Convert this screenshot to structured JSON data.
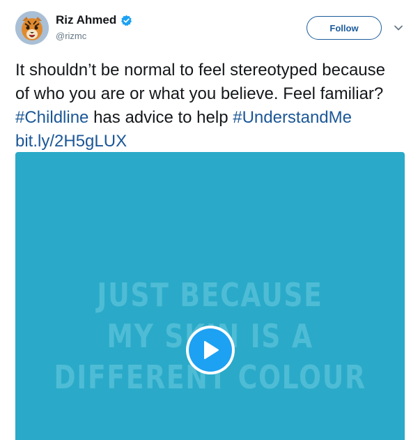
{
  "user": {
    "display_name": "Riz Ahmed",
    "handle": "@rizmc",
    "verified": true
  },
  "actions": {
    "follow_label": "Follow"
  },
  "tweet": {
    "text_part1": "It shouldn’t be normal to feel stereotyped because of who you are or what you believe. Feel familiar? ",
    "hashtag1": "#Childline",
    "text_part2": " has advice to help ",
    "hashtag2": "#UnderstandMe",
    "space": " ",
    "link": "bit.ly/2H5gLUX"
  },
  "media": {
    "type": "video",
    "overlay_text_lines": [
      "JUST BECAUSE",
      "MY SKIN IS A",
      "DIFFERENT COLOUR"
    ],
    "background_color": "#2aaac8"
  },
  "colors": {
    "link": "#1b5797",
    "accent": "#1da1f2",
    "follow_border": "#1c5b9b"
  }
}
